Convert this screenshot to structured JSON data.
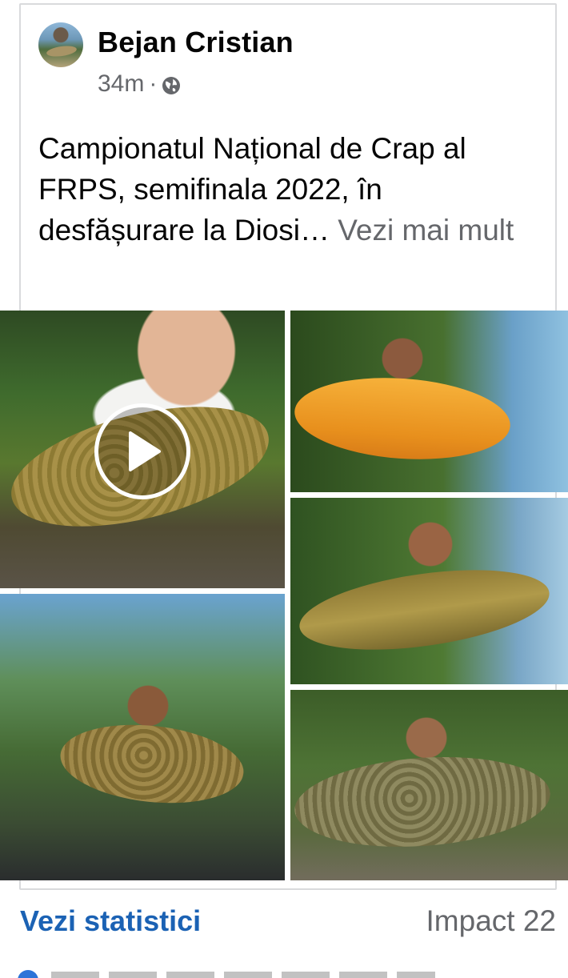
{
  "post": {
    "author": "Bejan Cristian",
    "time": "34m",
    "separator": "·",
    "privacy_icon": "globe-icon",
    "text": "Campionatul Național de Crap al FRPS, semifinala 2022, în desfășurare la Diosi…",
    "see_more": "Vezi mai mult"
  },
  "media": {
    "photos": [
      {
        "type": "video",
        "icon": "play-icon"
      },
      {
        "type": "photo"
      },
      {
        "type": "photo"
      },
      {
        "type": "photo"
      },
      {
        "type": "photo"
      }
    ]
  },
  "footer": {
    "stats_link": "Vezi statistici",
    "impact": "Impact 22"
  },
  "colors": {
    "link_blue": "#1b62b4",
    "secondary_text": "#65676b",
    "border": "#d9dadc"
  }
}
